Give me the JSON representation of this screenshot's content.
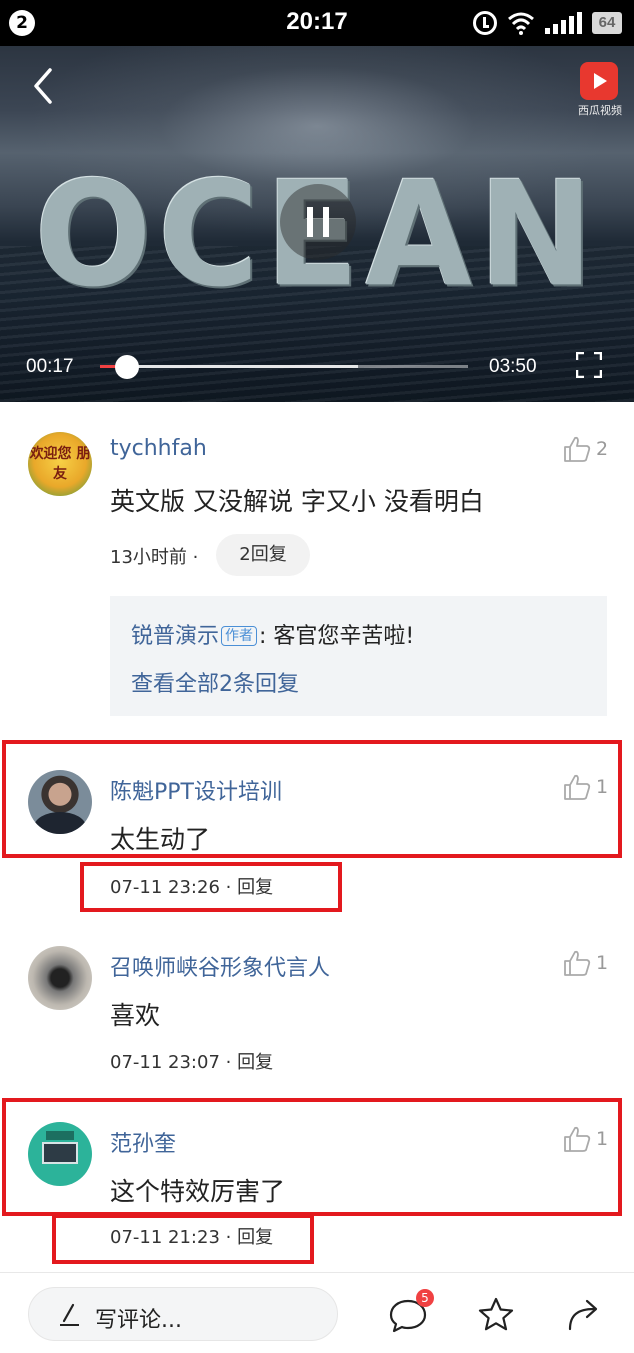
{
  "status_bar": {
    "notification_count": "2",
    "time": "20:17",
    "battery": "64"
  },
  "video": {
    "title_overlay": "OCEAN",
    "source_label": "西瓜视频",
    "current_time": "00:17",
    "total_time": "03:50",
    "progress_percent": 7.4,
    "buffered_percent": 70
  },
  "comments": [
    {
      "username": "tychhfah",
      "avatar_text": "欢迎您 朋友",
      "text": "英文版 又没解说 字又小 没看明白",
      "meta": "13小时前 ·",
      "reply_button": "2回复",
      "likes": "2",
      "reply_preview": {
        "author": "锐普演示",
        "badge": "作者",
        "text": ": 客官您辛苦啦!",
        "view_all": "查看全部2条回复"
      }
    },
    {
      "username": "陈魁PPT设计培训",
      "text": "太生动了",
      "meta": "07-11 23:26 · 回复",
      "likes": "1"
    },
    {
      "username": "召唤师峡谷形象代言人",
      "text": "喜欢",
      "meta": "07-11 23:07 · 回复",
      "likes": "1"
    },
    {
      "username": "范孙奎",
      "text": "这个特效厉害了",
      "meta": "07-11 21:23 · 回复",
      "likes": "1"
    }
  ],
  "bottom_bar": {
    "write_placeholder": "写评论...",
    "comment_badge": "5"
  },
  "colors": {
    "username_blue": "#406599",
    "highlight_red": "#e3191e",
    "progress_red": "#f04142"
  }
}
